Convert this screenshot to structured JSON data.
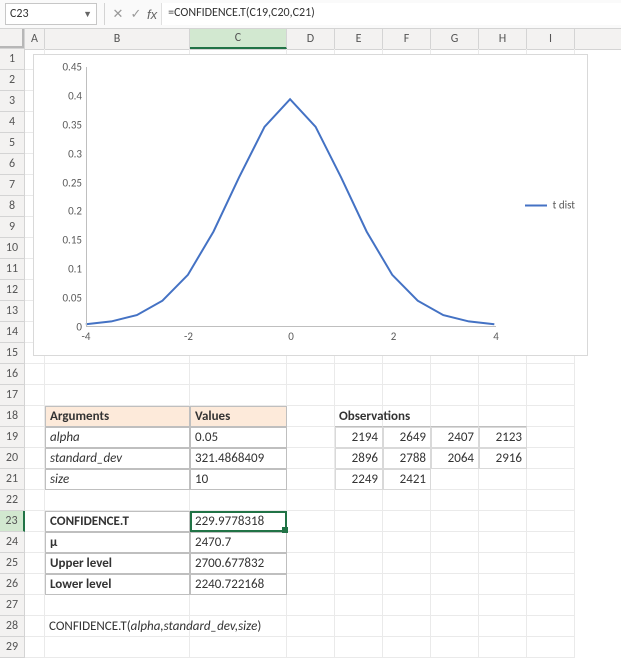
{
  "namebox": {
    "ref": "C23"
  },
  "formula_bar": {
    "fx_label": "fx",
    "value": "=CONFIDENCE.T(C19,C20,C21)"
  },
  "columns": [
    "A",
    "B",
    "C",
    "D",
    "E",
    "F",
    "G",
    "H",
    "I"
  ],
  "col_widths": {
    "A": 20,
    "B": 145,
    "C": 97,
    "D": 48,
    "E": 48,
    "F": 48,
    "G": 48,
    "H": 48,
    "I": 48
  },
  "active_col": "C",
  "active_row": 23,
  "row_headers": [
    1,
    2,
    3,
    4,
    5,
    6,
    7,
    8,
    9,
    10,
    11,
    12,
    13,
    14,
    15,
    16,
    17,
    18,
    19,
    20,
    21,
    22,
    23,
    24,
    25,
    26,
    27,
    28,
    29
  ],
  "chart_data": {
    "type": "line",
    "title": "",
    "legend": [
      "t dist"
    ],
    "x": [
      -4,
      -3.5,
      -3,
      -2.5,
      -2,
      -1.5,
      -1,
      -0.5,
      0,
      0.5,
      1,
      1.5,
      2,
      2.5,
      3,
      3.5,
      4
    ],
    "series": [
      {
        "name": "t dist",
        "values": [
          0.003,
          0.008,
          0.019,
          0.044,
          0.089,
          0.164,
          0.258,
          0.346,
          0.394,
          0.346,
          0.258,
          0.164,
          0.089,
          0.044,
          0.019,
          0.008,
          0.003
        ]
      }
    ],
    "xlim": [
      -4,
      4
    ],
    "ylim": [
      0,
      0.45
    ],
    "xticks": [
      -4,
      -2,
      0,
      2,
      4
    ],
    "yticks": [
      0,
      0.05,
      0.1,
      0.15,
      0.2,
      0.25,
      0.3,
      0.35,
      0.4,
      0.45
    ],
    "xlabel": "",
    "ylabel": ""
  },
  "args_table": {
    "headers": {
      "B": "Arguments",
      "C": "Values"
    },
    "rows": [
      {
        "B": "alpha",
        "C": "0.05"
      },
      {
        "B": "standard_dev",
        "C": "321.4868409"
      },
      {
        "B": "size",
        "C": "10"
      }
    ]
  },
  "result_table": {
    "rows": [
      {
        "B": "CONFIDENCE.T",
        "C": "229.9778318",
        "bold": true
      },
      {
        "B": "μ",
        "C": "2470.7",
        "bold": true
      },
      {
        "B": "Upper level",
        "C": "2700.677832",
        "bold": true
      },
      {
        "B": "Lower level",
        "C": "2240.722168",
        "bold": true
      }
    ]
  },
  "observations": {
    "header": "Observations",
    "rows": [
      [
        "2194",
        "2649",
        "2407",
        "2123"
      ],
      [
        "2896",
        "2788",
        "2064",
        "2916"
      ],
      [
        "2249",
        "2421",
        "",
        ""
      ]
    ]
  },
  "footer_syntax": "CONFIDENCE.T(alpha,standard_dev,size)"
}
